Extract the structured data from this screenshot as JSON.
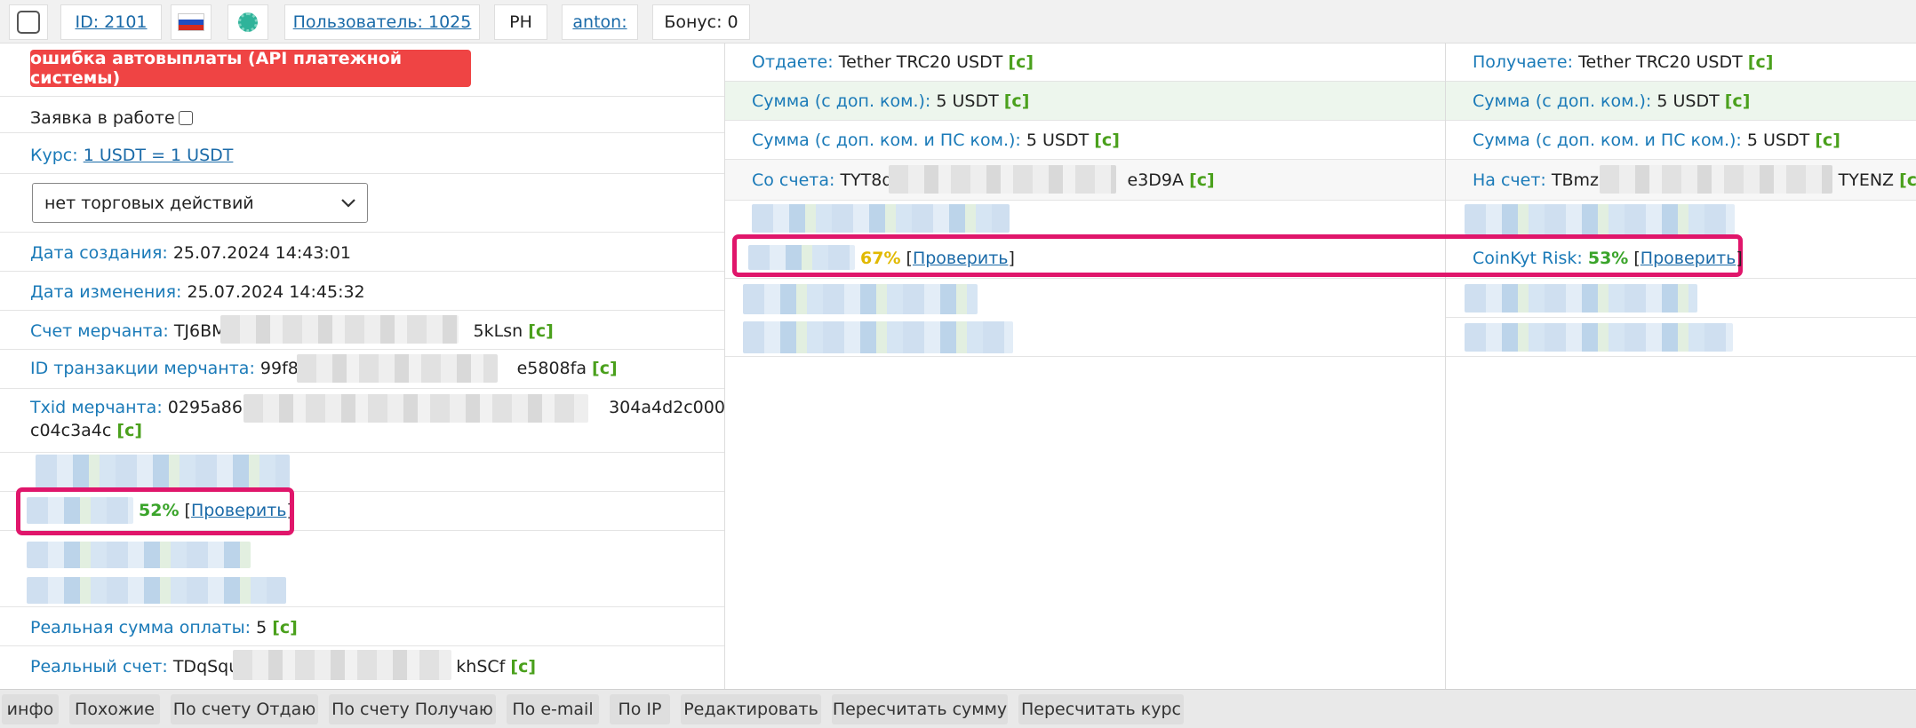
{
  "topbar": {
    "id": "ID: 2101",
    "user": "Пользователь: 1025",
    "ph": "PH",
    "anton": "anton:",
    "bonus": "Бонус: 0"
  },
  "left": {
    "error_button": "ошибка автовыплаты (API платежной системы)",
    "in_work": "Заявка в работе",
    "rate_label": "Курс:",
    "rate_value": "1 USDT = 1 USDT",
    "select_value": "нет торговых действий",
    "created_label": "Дата создания:",
    "created_value": "25.07.2024 14:43:01",
    "changed_label": "Дата изменения:",
    "changed_value": "25.07.2024 14:45:32",
    "merchant_account_label": "Счет мерчанта:",
    "merchant_account_start": "TJ6BMz",
    "merchant_account_end": "5kLsn",
    "merchant_tx_label": "ID транзакции мерчанта:",
    "merchant_tx_start": "99f8a0",
    "merchant_tx_end": "e5808fa",
    "txid_label": "Txid мерчанта:",
    "txid_start": "0295a86d3",
    "txid_end": "304a4d2c000",
    "txid_line2": "c04c3a4c",
    "risk_percent": "52%",
    "check_link": "Проверить",
    "real_sum_label": "Реальная сумма оплаты:",
    "real_sum_value": "5",
    "real_account_label": "Реальный счет:",
    "real_account_start": "TDqSqu",
    "real_account_end": "khSCf",
    "copy_mark": "[c]"
  },
  "middle": {
    "give_label": "Отдаете:",
    "give_value": "Tether TRC20 USDT",
    "sum1_label": "Сумма (с доп. ком.):",
    "sum1_value": "5 USDT",
    "sum2_label": "Сумма (с доп. ком. и ПС ком.):",
    "sum2_value": "5 USDT",
    "from_label": "Со счета:",
    "from_start": "TYT8q7",
    "from_end": "e3D9A",
    "risk_percent": "67%",
    "check_link": "Проверить"
  },
  "right": {
    "get_label": "Получаете:",
    "get_value": "Tether TRC20 USDT",
    "sum1_label": "Сумма (с доп. ком.):",
    "sum1_value": "5 USDT",
    "sum2_label": "Сумма (с доп. ком. и ПС ком.):",
    "sum2_value": "5 USDT",
    "to_label": "На счет:",
    "to_start": "TBmzo",
    "to_end": "TYENZ",
    "risk_label": "CoinKyt Risk:",
    "risk_percent": "53%",
    "check_link": "Проверить"
  },
  "bottombar": {
    "info": "инфо",
    "similar": "Похожие",
    "by_give": "По счету Отдаю",
    "by_get": "По счету Получаю",
    "by_email": "По e-mail",
    "by_ip": "По IP",
    "edit": "Редактировать",
    "recalc_sum": "Пересчитать сумму",
    "recalc_rate": "Пересчитать курс"
  },
  "colors": {
    "error": "#ef4444",
    "highlight": "#e0166b",
    "label": "#1a7ab8",
    "copy": "#4aa01c",
    "risk_yellow": "#e1b900",
    "risk_green": "#3aa42a"
  }
}
